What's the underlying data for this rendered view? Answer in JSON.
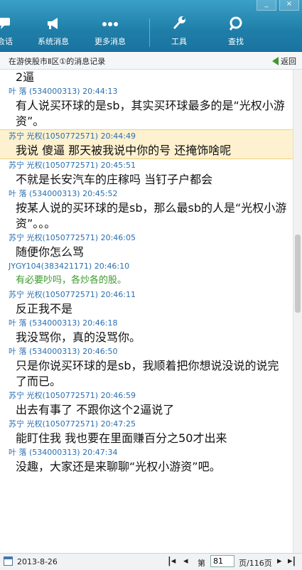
{
  "toolbar": {
    "items": [
      {
        "label": "会话",
        "icon": "chat-icon"
      },
      {
        "label": "系统消息",
        "icon": "megaphone-icon"
      },
      {
        "label": "更多消息",
        "icon": "more-icon"
      },
      {
        "label": "工具",
        "icon": "wrench-icon"
      },
      {
        "label": "查找",
        "icon": "search-icon"
      }
    ],
    "window_buttons": [
      "_",
      "×"
    ]
  },
  "header": {
    "title": "在游侠股市Ⅱ区①的消息记录",
    "back_label": "返回"
  },
  "messages": [
    {
      "body": "2逼"
    },
    {
      "sender": "叶  落",
      "id": "(534000313)",
      "time": "20:44:13",
      "body": "有人说买环球的是sb，其实买环球最多的是“光权小游资”。"
    },
    {
      "sender": "苏宁 光权(1050772571)",
      "id": "",
      "time": "20:44:49",
      "body": "我说 傻逼 那天被我说中你的号 还掩饰啥呢",
      "highlight": true
    },
    {
      "sender": "苏宁 光权(1050772571)",
      "id": "",
      "time": "20:45:51",
      "body": "不就是长安汽车的庄稼吗  当钉子户都会"
    },
    {
      "sender": "叶  落",
      "id": "(534000313)",
      "time": "20:45:52",
      "body": "按某人说的买环球的是sb，那么最sb的人是“光权小游资”。。。"
    },
    {
      "sender": "苏宁 光权(1050772571)",
      "id": "",
      "time": "20:46:05",
      "body": "随便你怎么骂"
    },
    {
      "sender": "JYGY104(383421171)",
      "id": "",
      "time": "20:46:10",
      "body": "有必要吵吗，各炒各的股。",
      "green": true
    },
    {
      "sender": "苏宁 光权(1050772571)",
      "id": "",
      "time": "20:46:11",
      "body": "反正我不是"
    },
    {
      "sender": "叶  落",
      "id": "(534000313)",
      "time": "20:46:18",
      "body": "我没骂你，真的没骂你。"
    },
    {
      "sender": "叶  落",
      "id": "(534000313)",
      "time": "20:46:50",
      "body": "只是你说买环球的是sb，我顺着把你想说没说的说完了而已。"
    },
    {
      "sender": "苏宁 光权(1050772571)",
      "id": "",
      "time": "20:46:59",
      "body": "出去有事了 不跟你这个2逼说了"
    },
    {
      "sender": "苏宁 光权(1050772571)",
      "id": "",
      "time": "20:47:25",
      "body": "能盯住我 我也要在里面赚百分之50才出来"
    },
    {
      "sender": "叶  落",
      "id": "(534000313)",
      "time": "20:47:34",
      "body": "没趣，大家还是来聊聊“光权小游资”吧。"
    }
  ],
  "footer": {
    "date": "2013-8-26",
    "page_prefix": "第",
    "page_value": "81",
    "page_suffix": "页/116页"
  },
  "colors": {
    "toolbar": "#1f7ea8",
    "sender": "#2a6fb0",
    "highlight": "#fdf1cf",
    "green_text": "#3a9a2a"
  }
}
